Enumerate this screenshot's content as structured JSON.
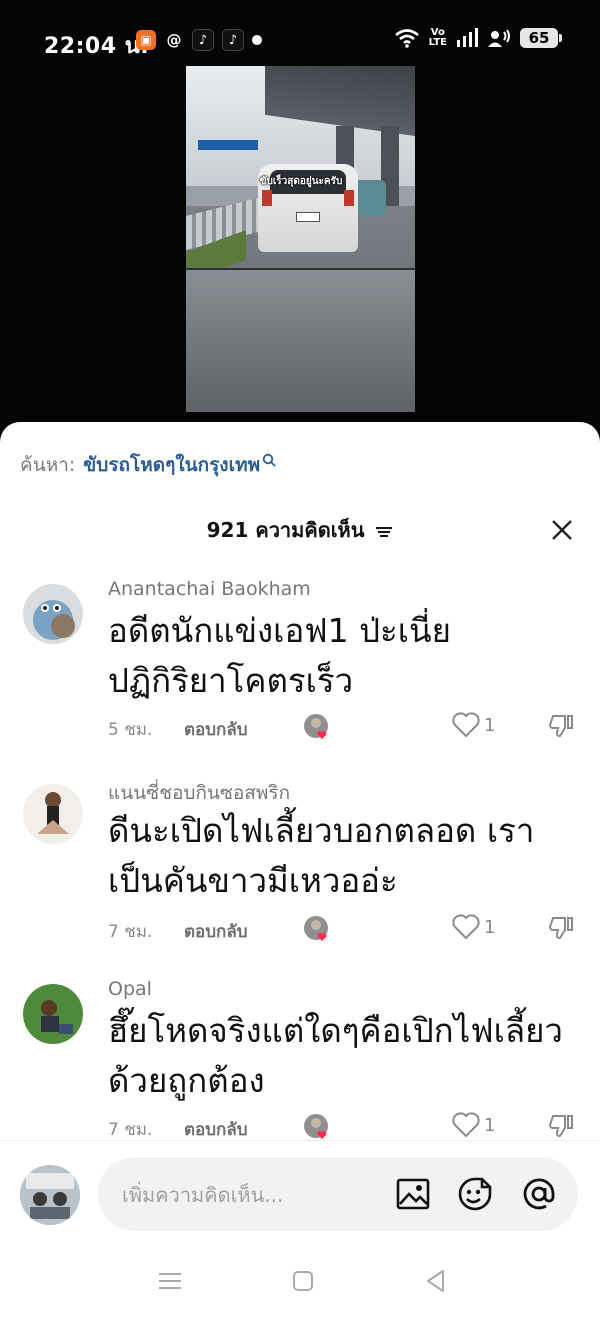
{
  "status_bar": {
    "time": "22:04 น.",
    "volte": "Vo\nLTE",
    "battery": "65"
  },
  "video": {
    "caption": "ขับเร็วสุดอยู่นะครับ"
  },
  "search_suggestion": {
    "prefix": "ค้นหา:",
    "term": "ขับรถโหดๆในกรุงเทพ"
  },
  "comments_header": {
    "count_label": "921 ความคิดเห็น"
  },
  "comments": [
    {
      "author": "Anantachai Baokham",
      "text": "อดีตนักแข่งเอฟ1 ป่ะเนี่ย ปฏิกิริยาโคตรเร็ว",
      "time": "5 ชม.",
      "reply_label": "ตอบกลับ",
      "likes": "1"
    },
    {
      "author": "แนนซี่ชอบกินซอสพริก",
      "text": "ดีนะเปิดไฟเลี้ยวบอกตลอด เราเป็นคันขาวมีเหวออ่ะ",
      "time": "7 ชม.",
      "reply_label": "ตอบกลับ",
      "likes": "1"
    },
    {
      "author": "Opal",
      "text": "ฮึ๊ยโหดจริงแต่ใดๆคือเปิกไฟเลี้ยวด้วยถูกต้อง",
      "time": "7 ชม.",
      "reply_label": "ตอบกลับ",
      "likes": "1"
    }
  ],
  "composer": {
    "placeholder": "เพิ่มความคิดเห็น..."
  },
  "colors": {
    "search_term": "#2d5d95",
    "like_heart": "#fe2c55",
    "sheet_bg": "#ffffff",
    "input_bg": "#f2f2f2"
  },
  "icons": [
    "search-icon",
    "sort-icon",
    "close-icon",
    "heart-icon",
    "dislike-icon",
    "image-icon",
    "emoji-icon",
    "mention-icon"
  ]
}
